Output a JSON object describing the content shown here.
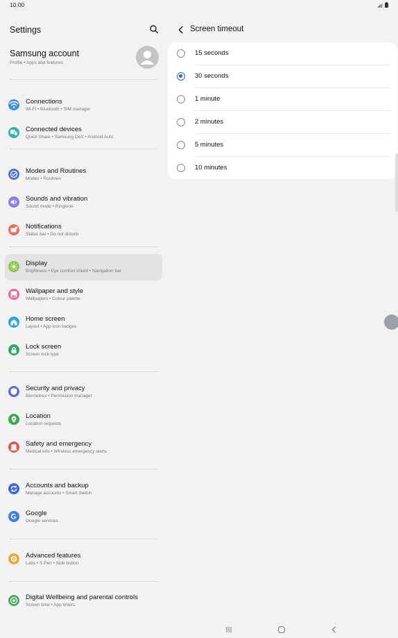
{
  "status_bar": {
    "time": "10.00"
  },
  "left_pane": {
    "title": "Settings",
    "account": {
      "name": "Samsung account",
      "subtitle": "Profile  •  Apps and features"
    },
    "items": [
      {
        "title": "Connections",
        "subtitle": "Wi-Fi  •  Bluetooth  •  SIM manager",
        "color": "#3d8ee8",
        "icon": "wifi-icon"
      },
      {
        "title": "Connected devices",
        "subtitle": "Quick Share  •  Samsung DeX  •  Android Auto",
        "color": "#31b3b0",
        "icon": "devices-icon"
      },
      {
        "title": "Modes and Routines",
        "subtitle": "Modes  •  Routines",
        "color": "#4f6bdc",
        "icon": "check-circle-icon"
      },
      {
        "title": "Sounds and vibration",
        "subtitle": "Sound mode  •  Ringtone",
        "color": "#8d7be8",
        "icon": "speaker-icon"
      },
      {
        "title": "Notifications",
        "subtitle": "Status bar  •  Do not disturb",
        "color": "#ee6b5b",
        "icon": "notification-icon"
      },
      {
        "title": "Display",
        "subtitle": "Brightness  •  Eye comfort shield  •  Navigation bar",
        "color": "#8cc43f",
        "icon": "sun-icon"
      },
      {
        "title": "Wallpaper and style",
        "subtitle": "Wallpapers  •  Colour palette",
        "color": "#e9668e",
        "icon": "image-icon"
      },
      {
        "title": "Home screen",
        "subtitle": "Layout  •  App icon badges",
        "color": "#29a8d8",
        "icon": "home-icon"
      },
      {
        "title": "Lock screen",
        "subtitle": "Screen lock type",
        "color": "#2ea86a",
        "icon": "lock-icon"
      },
      {
        "title": "Security and privacy",
        "subtitle": "Biometrics  •  Permission manager",
        "color": "#5a6de0",
        "icon": "shield-icon"
      },
      {
        "title": "Location",
        "subtitle": "Location requests",
        "color": "#39a94d",
        "icon": "location-icon"
      },
      {
        "title": "Safety and emergency",
        "subtitle": "Medical info  •  Wireless emergency alerts",
        "color": "#e2574c",
        "icon": "alert-icon"
      },
      {
        "title": "Accounts and backup",
        "subtitle": "Manage accounts  •  Smart Switch",
        "color": "#3b68d6",
        "icon": "sync-icon"
      },
      {
        "title": "Google",
        "subtitle": "Google services",
        "color": "#3f7fe8",
        "icon": "google-icon"
      },
      {
        "title": "Advanced features",
        "subtitle": "Labs  •  S Pen  •  Side button",
        "color": "#f2a62f",
        "icon": "gear-icon"
      },
      {
        "title": "Digital Wellbeing and parental controls",
        "subtitle": "Screen time  •  App timers",
        "color": "#45ae5e",
        "icon": "heart-icon"
      }
    ]
  },
  "right_pane": {
    "title": "Screen timeout",
    "accent": "#2c62d8",
    "options": [
      {
        "label": "15 seconds",
        "selected": false
      },
      {
        "label": "30 seconds",
        "selected": true
      },
      {
        "label": "1 minute",
        "selected": false
      },
      {
        "label": "2 minutes",
        "selected": false
      },
      {
        "label": "5 minutes",
        "selected": false
      },
      {
        "label": "10 minutes",
        "selected": false
      }
    ]
  }
}
